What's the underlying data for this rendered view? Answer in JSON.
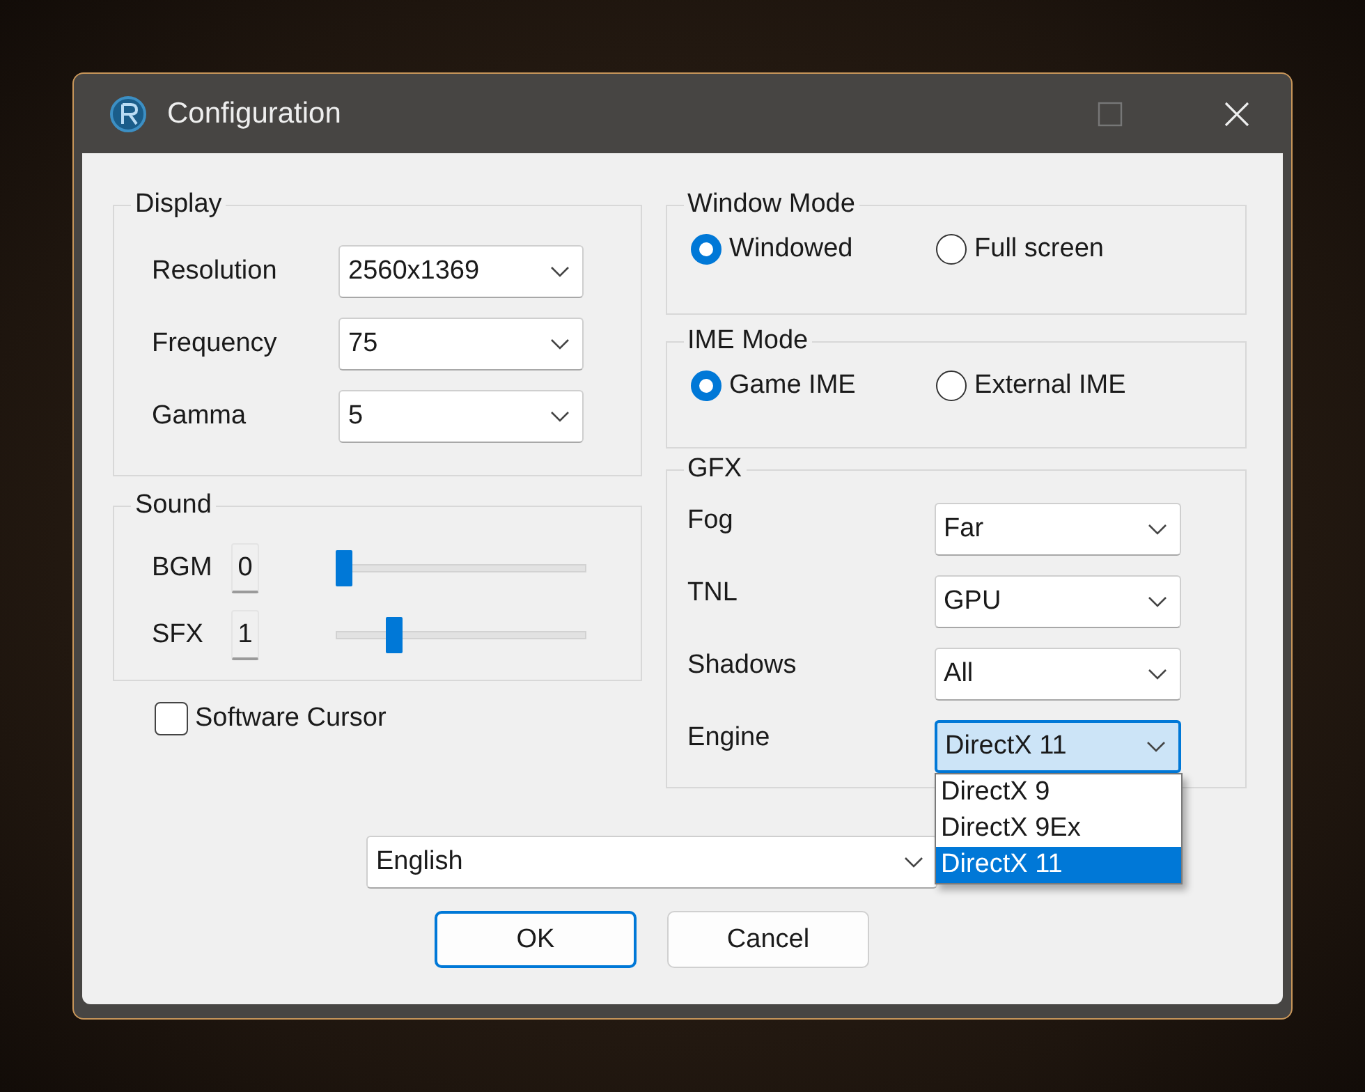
{
  "window": {
    "title": "Configuration"
  },
  "display": {
    "title": "Display",
    "fields": [
      {
        "label": "Resolution",
        "value": "2560x1369"
      },
      {
        "label": "Frequency",
        "value": "75"
      },
      {
        "label": "Gamma",
        "value": "5"
      }
    ]
  },
  "sound": {
    "title": "Sound",
    "channels": [
      {
        "name": "BGM",
        "value": "0",
        "level": 0
      },
      {
        "name": "SFX",
        "value": "1",
        "level": 0.2
      }
    ]
  },
  "software_cursor": {
    "label": "Software Cursor",
    "checked": false
  },
  "window_mode": {
    "title": "Window Mode",
    "options": [
      {
        "label": "Windowed",
        "selected": true
      },
      {
        "label": "Full screen",
        "selected": false
      }
    ]
  },
  "ime_mode": {
    "title": "IME Mode",
    "options": [
      {
        "label": "Game IME",
        "selected": true
      },
      {
        "label": "External IME",
        "selected": false
      }
    ]
  },
  "gfx": {
    "title": "GFX",
    "fields": [
      {
        "label": "Fog",
        "value": "Far",
        "focused": false
      },
      {
        "label": "TNL",
        "value": "GPU",
        "focused": false
      },
      {
        "label": "Shadows",
        "value": "All",
        "focused": false
      },
      {
        "label": "Engine",
        "value": "DirectX 11",
        "focused": true
      }
    ]
  },
  "engine_dropdown": {
    "options": [
      {
        "label": "DirectX 9",
        "selected": false
      },
      {
        "label": "DirectX 9Ex",
        "selected": false
      },
      {
        "label": "DirectX 11",
        "selected": true
      }
    ]
  },
  "language": {
    "value": "English"
  },
  "buttons": [
    {
      "label": "OK",
      "default": true
    },
    {
      "label": "Cancel",
      "default": false
    }
  ]
}
